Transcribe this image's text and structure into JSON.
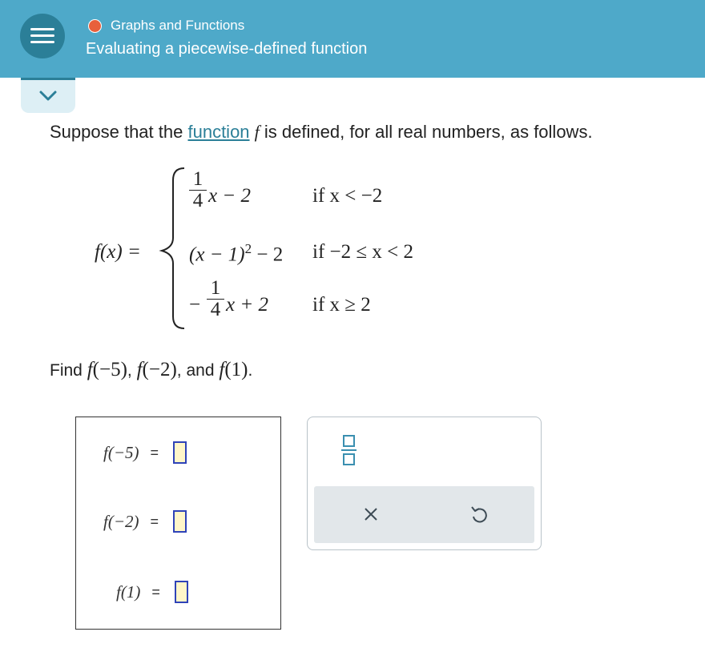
{
  "header": {
    "menu_icon": "hamburger-menu-icon",
    "topic": "Graphs and Functions",
    "topic_status_color": "#e8603c",
    "lesson_title": "Evaluating a piecewise-defined function",
    "collapse_icon": "chevron-down-icon",
    "bar_color": "#4ea9c9"
  },
  "problem": {
    "intro_before": "Suppose that the",
    "link_text": "function",
    "var_f": "f",
    "intro_after": "is defined, for all real numbers, as follows.",
    "definition": {
      "lhs": "f(x) =",
      "pieces": [
        {
          "expr_num": "1",
          "expr_den": "4",
          "expr_rest": "x − 2",
          "condition": "if x < −2"
        },
        {
          "expr": "(x − 1)",
          "exponent": "2",
          "expr_tail": "− 2",
          "condition": "if −2 ≤ x < 2"
        },
        {
          "sign": "−",
          "expr_num": "1",
          "expr_den": "4",
          "expr_rest": "x + 2",
          "condition": "if x ≥ 2"
        }
      ]
    },
    "find_label": "Find",
    "find_items": [
      "(−5)",
      "(−2)",
      "(1)"
    ],
    "find_sep1": ",",
    "find_sep2": ", and",
    "find_end": "."
  },
  "answers": [
    {
      "label": "f(−5)",
      "equals": "=",
      "value": ""
    },
    {
      "label": "f(−2)",
      "equals": "=",
      "value": ""
    },
    {
      "label": "f(1)",
      "equals": "=",
      "value": ""
    }
  ],
  "tools": {
    "fraction_icon": "fraction-template-icon",
    "clear_icon": "x-clear-icon",
    "undo_icon": "undo-icon"
  }
}
